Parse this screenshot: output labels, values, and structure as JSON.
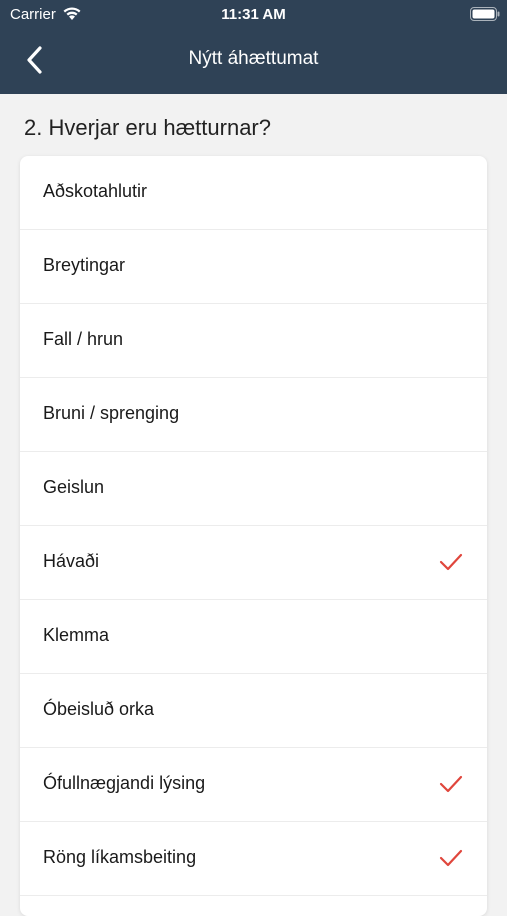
{
  "status_bar": {
    "carrier": "Carrier",
    "time": "11:31 AM",
    "wifi_icon": "wifi-icon",
    "battery_icon": "battery-icon"
  },
  "nav": {
    "title": "Nýtt áhættumat",
    "back_icon": "chevron-left-icon"
  },
  "question": "2. Hverjar eru hætturnar?",
  "colors": {
    "header": "#2f4256",
    "check": "#e0463c",
    "background": "#f2f2f2"
  },
  "hazards": [
    {
      "label": "Aðskotahlutir",
      "selected": false
    },
    {
      "label": "Breytingar",
      "selected": false
    },
    {
      "label": "Fall / hrun",
      "selected": false
    },
    {
      "label": "Bruni / sprenging",
      "selected": false
    },
    {
      "label": "Geislun",
      "selected": false
    },
    {
      "label": "Hávaði",
      "selected": true
    },
    {
      "label": "Klemma",
      "selected": false
    },
    {
      "label": "Óbeisluð orka",
      "selected": false
    },
    {
      "label": "Ófullnægjandi lýsing",
      "selected": true
    },
    {
      "label": "Röng líkamsbeiting",
      "selected": true
    }
  ]
}
